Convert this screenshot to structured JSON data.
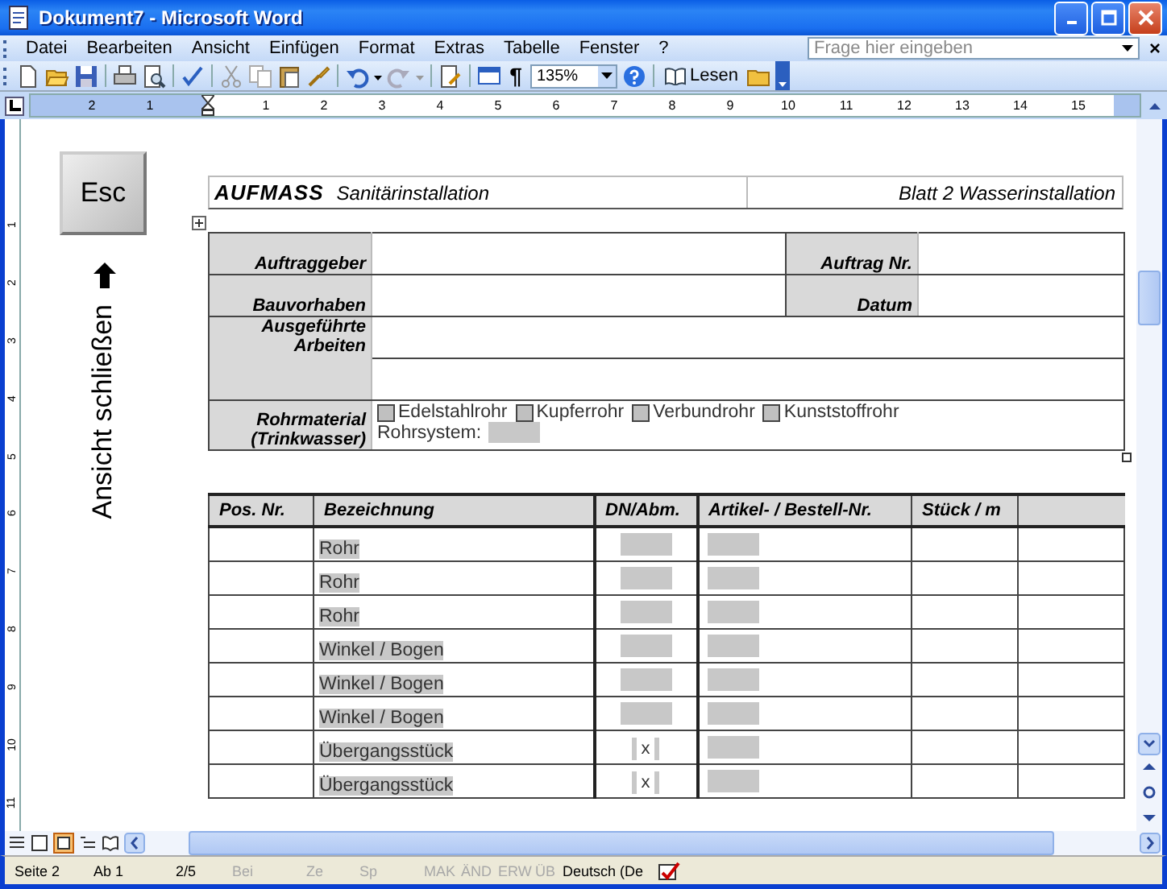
{
  "window": {
    "title": "Dokument7 - Microsoft Word"
  },
  "menu": {
    "items": [
      "Datei",
      "Bearbeiten",
      "Ansicht",
      "Einfügen",
      "Format",
      "Extras",
      "Tabelle",
      "Fenster",
      "?"
    ],
    "help_field": {
      "placeholder": "Frage hier eingeben"
    },
    "close": "×"
  },
  "toolbar": {
    "pilcrow": "¶",
    "zoom": "135%",
    "read_button": "Lesen"
  },
  "ruler": {
    "left_labels": [
      "2",
      "1"
    ],
    "labels": [
      "1",
      "2",
      "3",
      "4",
      "5",
      "6",
      "7",
      "8",
      "9",
      "10",
      "11",
      "12",
      "13",
      "14",
      "15"
    ]
  },
  "vertical_ruler": {
    "labels": [
      "1",
      "2",
      "3",
      "4",
      "5",
      "6",
      "7",
      "8",
      "9",
      "10",
      "11"
    ]
  },
  "side": {
    "esc_button": "Esc",
    "close_view": "Ansicht schließen"
  },
  "header": {
    "title": "AUFMASS",
    "subtitle": "Sanitärinstallation",
    "sheet": "Blatt 2 Wasserinstallation"
  },
  "form": {
    "client": "Auftraggeber",
    "order_no": "Auftrag Nr.",
    "project": "Bauvorhaben",
    "date": "Datum",
    "work": "Ausgeführte Arbeiten",
    "material": "Rohrmaterial (Trinkwasser)",
    "options": [
      {
        "label": "Edelstahlrohr",
        "checked": false
      },
      {
        "label": "Kupferrohr",
        "checked": false
      },
      {
        "label": "Verbundrohr",
        "checked": false
      },
      {
        "label": "Kunststoffrohr",
        "checked": false
      }
    ],
    "system_label": "Rohrsystem:"
  },
  "table": {
    "columns": [
      "Pos. Nr.",
      "Bezeichnung",
      "DN/Abm.",
      "Artikel- / Bestell-Nr.",
      "Stück / m"
    ],
    "rows": [
      {
        "name": "Rohr",
        "dn": {
          "kind": "field"
        }
      },
      {
        "name": "Rohr",
        "dn": {
          "kind": "field"
        }
      },
      {
        "name": "Rohr",
        "dn": {
          "kind": "field"
        }
      },
      {
        "name": "Winkel / Bogen",
        "dn": {
          "kind": "field"
        }
      },
      {
        "name": "Winkel / Bogen",
        "dn": {
          "kind": "field"
        }
      },
      {
        "name": "Winkel / Bogen",
        "dn": {
          "kind": "field"
        }
      },
      {
        "name": "Übergangsstück",
        "dn": {
          "kind": "choice",
          "text": "x"
        }
      },
      {
        "name": "Übergangsstück",
        "dn": {
          "kind": "choice",
          "text": "x"
        }
      }
    ]
  },
  "status_bar": {
    "items": [
      {
        "text": "Seite 2",
        "disabled": false
      },
      {
        "text": "Ab 1",
        "disabled": false
      },
      {
        "text": "2/5",
        "disabled": false
      },
      {
        "text": "Bei",
        "disabled": true
      },
      {
        "text": "Ze",
        "disabled": true
      },
      {
        "text": "Sp",
        "disabled": true
      },
      {
        "text": "MAK",
        "disabled": true
      },
      {
        "text": "ÄND",
        "disabled": true
      },
      {
        "text": "ERW",
        "disabled": true
      },
      {
        "text": "ÜB",
        "disabled": true
      },
      {
        "text": "Deutsch (De",
        "disabled": false
      }
    ]
  }
}
